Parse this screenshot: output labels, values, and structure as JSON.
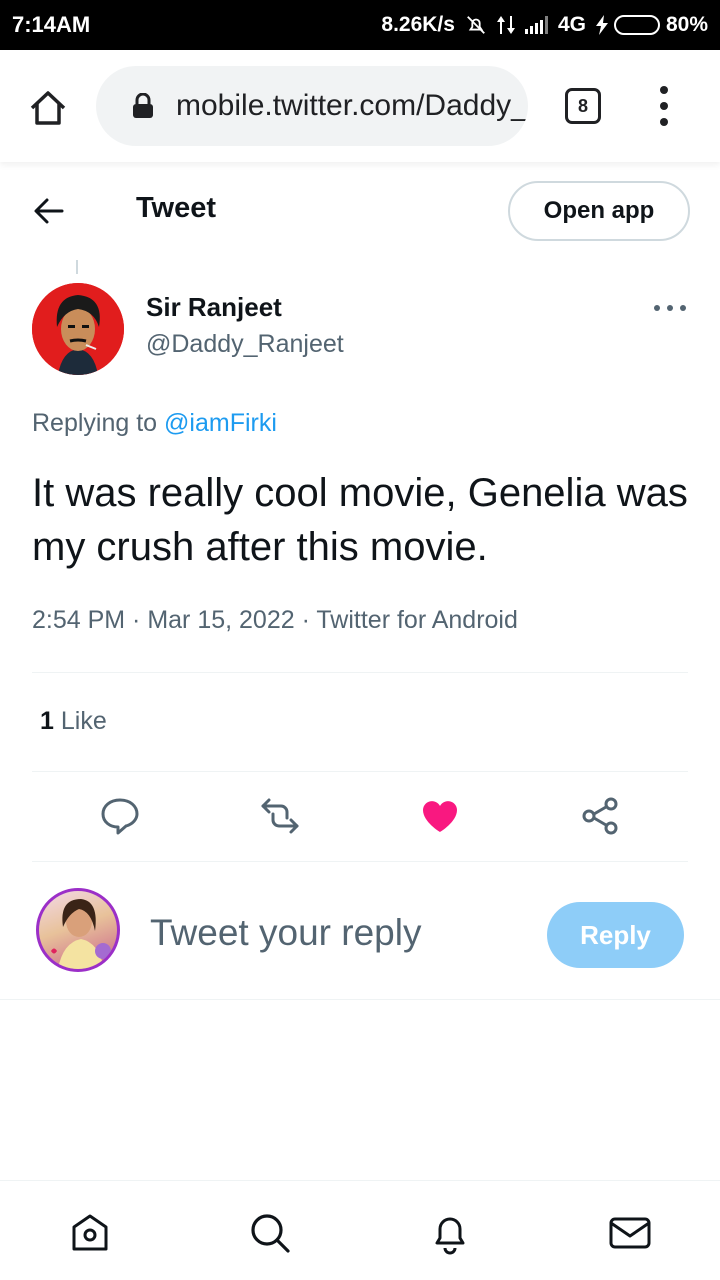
{
  "status_bar": {
    "time": "7:14AM",
    "net_speed": "8.26K/s",
    "network": "4G",
    "battery": "80%",
    "battery_level": 0.8
  },
  "browser": {
    "url": "mobile.twitter.com/Daddy_Ranjeet",
    "tab_count": "8"
  },
  "header": {
    "title": "Tweet",
    "open_app_label": "Open app"
  },
  "tweet": {
    "author_name": "Sir Ranjeet",
    "author_handle": "@Daddy_Ranjeet",
    "replying_prefix": "Replying to",
    "replying_to": "@iamFirki",
    "text": "It was really cool movie, Genelia was my crush after this movie.",
    "meta": "2:54 PM · Mar 15, 2022 · Twitter for Android",
    "like_count": "1",
    "like_label": "Like",
    "liked": true
  },
  "composer": {
    "placeholder": "Tweet your reply",
    "reply_label": "Reply"
  },
  "icons": {
    "home": "home-icon",
    "search": "search-icon",
    "notifications": "bell-icon",
    "messages": "mail-icon"
  },
  "colors": {
    "accent": "#1d9bf0",
    "like": "#f91880",
    "reply_button": "#8ecdf8",
    "muted_text": "#536471"
  }
}
